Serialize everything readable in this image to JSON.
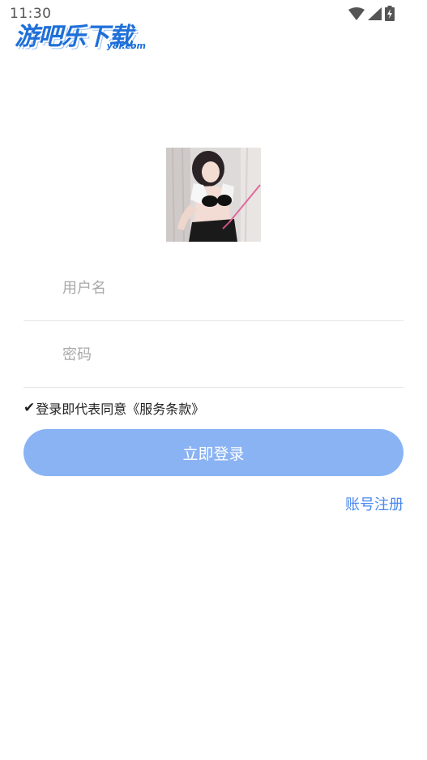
{
  "status_bar": {
    "time": "11:30",
    "icons": [
      "wifi-icon",
      "signal-icon",
      "battery-icon"
    ]
  },
  "watermark": {
    "title": "游吧乐下载",
    "subtitle": "y8l.com"
  },
  "login": {
    "username_placeholder": "用户名",
    "password_placeholder": "密码",
    "agreement_text": "登录即代表同意《服务条款》",
    "login_button": "立即登录",
    "register_link": "账号注册"
  },
  "colors": {
    "button_bg": "#8ab3f3",
    "link": "#4a88ee",
    "watermark": "#1e6fd9"
  }
}
